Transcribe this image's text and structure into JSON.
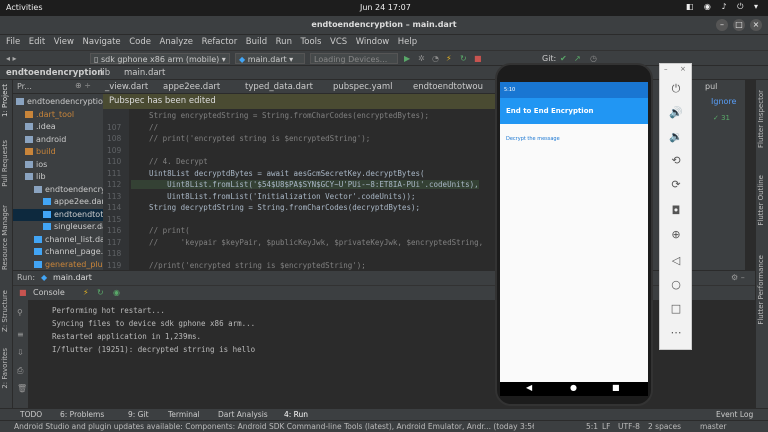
{
  "system": {
    "activities": "Activities",
    "clock": "Jun 24  17:07"
  },
  "window": {
    "title": "endtoendencryption – main.dart"
  },
  "menu": [
    "File",
    "Edit",
    "View",
    "Navigate",
    "Code",
    "Analyze",
    "Refactor",
    "Build",
    "Run",
    "Tools",
    "VCS",
    "Window",
    "Help"
  ],
  "toolbar": {
    "device": "sdk gphone x86 arm (mobile)",
    "run_config": "main.dart",
    "loading": "Loading Devices...",
    "git_label": "Git:"
  },
  "breadcrumbs": [
    "endtoendencryption",
    "lib",
    "main.dart"
  ],
  "project": {
    "header": "Pr...",
    "rows": [
      {
        "label": "endtoendencryption",
        "indent": 0,
        "type": "folder",
        "selected": false
      },
      {
        "label": ".dart_tool",
        "indent": 1,
        "type": "folder-orange",
        "selected": false
      },
      {
        "label": ".idea",
        "indent": 1,
        "type": "folder",
        "selected": false
      },
      {
        "label": "android",
        "indent": 1,
        "type": "folder",
        "selected": false
      },
      {
        "label": "build",
        "indent": 1,
        "type": "folder-orange",
        "selected": false
      },
      {
        "label": "ios",
        "indent": 1,
        "type": "folder",
        "selected": false
      },
      {
        "label": "lib",
        "indent": 1,
        "type": "folder",
        "selected": false
      },
      {
        "label": "endtoendencryp",
        "indent": 2,
        "type": "folder",
        "selected": false
      },
      {
        "label": "appe2ee.dart",
        "indent": 3,
        "type": "dart",
        "selected": false
      },
      {
        "label": "endtoendtotw",
        "indent": 3,
        "type": "dart",
        "selected": true
      },
      {
        "label": "singleuser.da",
        "indent": 3,
        "type": "dart",
        "selected": false
      },
      {
        "label": "channel_list.dar",
        "indent": 2,
        "type": "dart",
        "selected": false
      },
      {
        "label": "channel_page.da",
        "indent": 2,
        "type": "dart",
        "selected": false
      },
      {
        "label": "generated_plug",
        "indent": 2,
        "type": "dart-orange",
        "selected": false
      }
    ]
  },
  "tabs": [
    "_view.dart",
    "appe2ee.dart",
    "typed_data.dart",
    "pubspec.yaml",
    "endtoendtotwou"
  ],
  "banner": {
    "text": "Pubspec has been edited",
    "ignore": "Ignore"
  },
  "editor": {
    "lines": [
      {
        "n": "",
        "text": "    String encryptedString = String.fromCharCodes(encryptedBytes);",
        "cls": "cmt"
      },
      {
        "n": "107",
        "text": "    //",
        "cls": "cmt"
      },
      {
        "n": "108",
        "text": "    // print('encrypted string is $encryptedString');",
        "cls": "cmt"
      },
      {
        "n": "109",
        "text": "",
        "cls": "plain"
      },
      {
        "n": "110",
        "text": "    // 4. Decrypt",
        "cls": "cmt"
      },
      {
        "n": "111",
        "text": "    Uint8List decryptdBytes = await aesGcmSecretKey.decryptBytes(",
        "cls": "plain"
      },
      {
        "n": "112",
        "text": "        Uint8List.fromList('$54$U8$PA$SYN$GCY~U'PUi-~8:ET8IA-PUi'.codeUnits),",
        "cls": "hl"
      },
      {
        "n": "113",
        "text": "        Uint8List.fromList('Initialization Vector'.codeUnits));",
        "cls": "plain"
      },
      {
        "n": "114",
        "text": "    String decryptdString = String.fromCharCodes(decryptdBytes);",
        "cls": "plain"
      },
      {
        "n": "115",
        "text": "",
        "cls": "plain"
      },
      {
        "n": "116",
        "text": "    // print(",
        "cls": "cmt"
      },
      {
        "n": "117",
        "text": "    //     'keypair $keyPair, $publicKeyJwk, $privateKeyJwk, $encryptedString,",
        "cls": "cmt"
      },
      {
        "n": "118",
        "text": "",
        "cls": "plain"
      },
      {
        "n": "119",
        "text": "    //print('encrypted string is $encryptedString');",
        "cls": "cmt"
      }
    ]
  },
  "run": {
    "label": "Run:",
    "config": "main.dart",
    "console_tab": "Console",
    "lines": [
      "Performing hot restart...",
      "Syncing files to device sdk gphone x86 arm...",
      "Restarted application in 1,239ms.",
      "I/flutter (19251): decrypted strring is hello"
    ]
  },
  "bottom_tabs": [
    "TODO",
    "6: Problems",
    "9: Git",
    "Terminal",
    "Dart Analysis",
    "4: Run"
  ],
  "event_log": "Event Log",
  "status": {
    "message": "Android Studio and plugin updates available: Components: Android SDK Command-line Tools (latest), Android Emulator, Andr... (today 3:56 PM)",
    "position": "5:1",
    "line_sep": "LF",
    "encoding": "UTF-8",
    "indent": "2 spaces",
    "vcs": "master"
  },
  "side_tabs": {
    "left": [
      "1: Project",
      "Pull Requests",
      "Resource Manager",
      "Z: Structure",
      "2: Favorites"
    ],
    "right": [
      "Flutter Inspector",
      "Flutter Outline",
      "Flutter Performance"
    ]
  },
  "phone": {
    "status_time": "5:10",
    "app_title": "End to End Encryption",
    "button_text": "Decrypt the message"
  },
  "emulator_buttons": [
    "power-icon",
    "volume-up-icon",
    "volume-down-icon",
    "rotate-left-icon",
    "rotate-right-icon",
    "camera-icon",
    "zoom-icon",
    "back-icon",
    "home-icon",
    "overview-icon",
    "more-icon"
  ],
  "colors": {
    "ide_bg": "#2b2b2b",
    "panel": "#3c3f41",
    "app_bar": "#2196f3",
    "status_bar": "#1976d2"
  }
}
